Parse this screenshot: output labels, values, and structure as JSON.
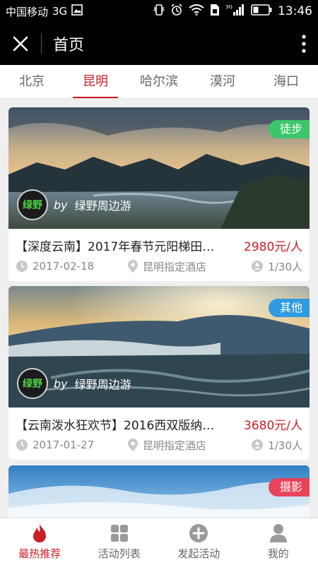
{
  "status_bar": {
    "carrier": "中国移动",
    "network": "3G",
    "network_small": "3G",
    "time": "13:46"
  },
  "header": {
    "title": "首页"
  },
  "city_tabs": [
    {
      "label": "北京"
    },
    {
      "label": "昆明"
    },
    {
      "label": "哈尔滨"
    },
    {
      "label": "漠河"
    },
    {
      "label": "海口"
    }
  ],
  "active_city": "昆明",
  "cards": [
    {
      "badge": "徒步",
      "badge_color": "#3cc66b",
      "organizer_logo": "绿野",
      "organizer_by": "by",
      "organizer": "绿野周边游",
      "title": "【深度云南】2017年春节元阳梯田…",
      "price": "2980元/人",
      "date": "2017-02-18",
      "location": "昆明指定酒店",
      "people": "1/30人"
    },
    {
      "badge": "其他",
      "badge_color": "#2f9be0",
      "organizer_logo": "绿野",
      "organizer_by": "by",
      "organizer": "绿野周边游",
      "title": "【云南泼水狂欢节】2016西双版纳…",
      "price": "3680元/人",
      "date": "2017-01-27",
      "location": "昆明指定酒店",
      "people": "1/30人"
    },
    {
      "badge": "摄影",
      "badge_color": "#e8435a"
    }
  ],
  "bottom_nav": [
    {
      "label": "最热推荐",
      "icon": "flame-icon"
    },
    {
      "label": "活动列表",
      "icon": "grid-icon"
    },
    {
      "label": "发起活动",
      "icon": "plus-circle-icon"
    },
    {
      "label": "我的",
      "icon": "person-icon"
    }
  ],
  "colors": {
    "accent": "#c81f26",
    "header_bg": "#000000"
  }
}
